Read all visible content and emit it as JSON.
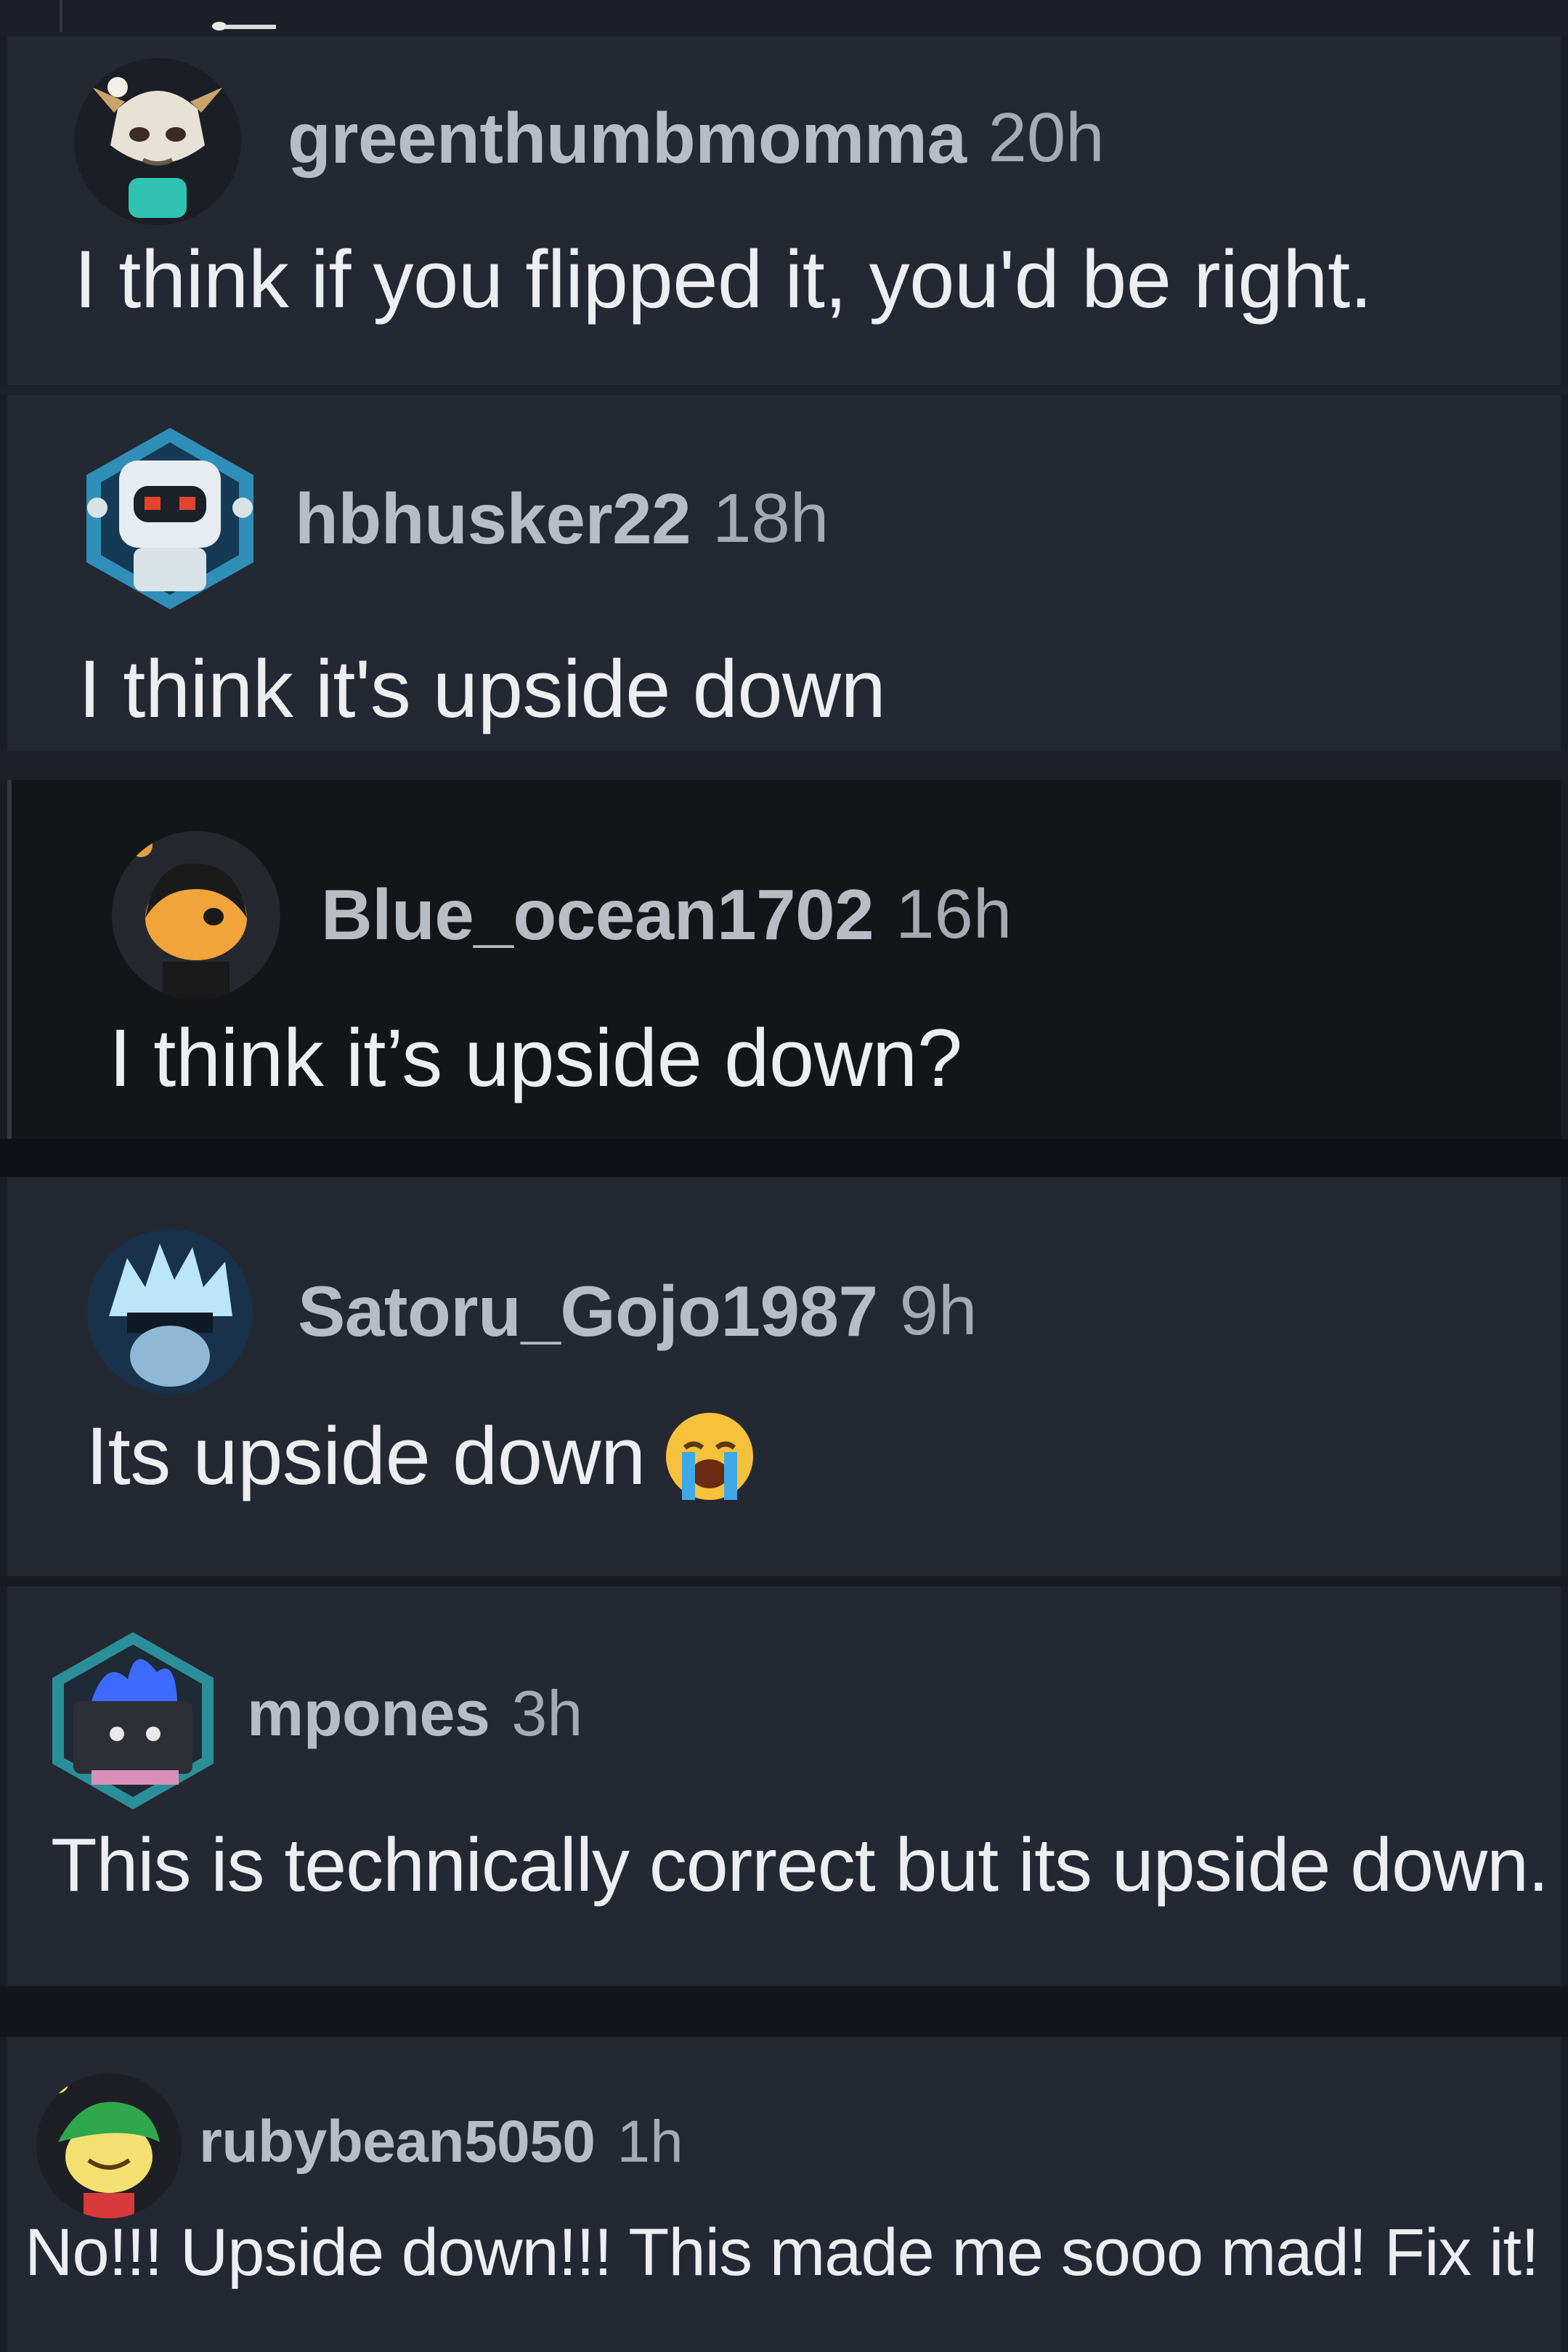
{
  "comments": [
    {
      "username": "greenthumbmomma",
      "time": "20h",
      "text": "I think if you flipped it, you'd be right."
    },
    {
      "username": "hbhusker22",
      "time": "18h",
      "text": "I think it's upside down"
    },
    {
      "username": "Blue_ocean1702",
      "time": "16h",
      "text": "I think it’s upside down?"
    },
    {
      "username": "Satoru_Gojo1987",
      "time": "9h",
      "text": "Its upside down",
      "emoji": "😭"
    },
    {
      "username": "mpones",
      "time": "3h",
      "text": "This is technically correct but its upside down."
    },
    {
      "username": "rubybean5050",
      "time": "1h",
      "text": "No!!! Upside down!!! This made me sooo mad! Fix it!"
    }
  ],
  "colors": {
    "background": "#1a1d24",
    "panel": "#232833",
    "highlighted_panel": "#141518",
    "username": "#b8bcc4",
    "comment_text": "#eceef1"
  },
  "icons": [
    "goat-avatar-icon",
    "robot-avatar-icon",
    "snoo-avatar-icon",
    "white-hair-avatar-icon",
    "trash-fire-avatar-icon",
    "green-hat-snoo-avatar-icon",
    "loudly-crying-face-emoji"
  ]
}
